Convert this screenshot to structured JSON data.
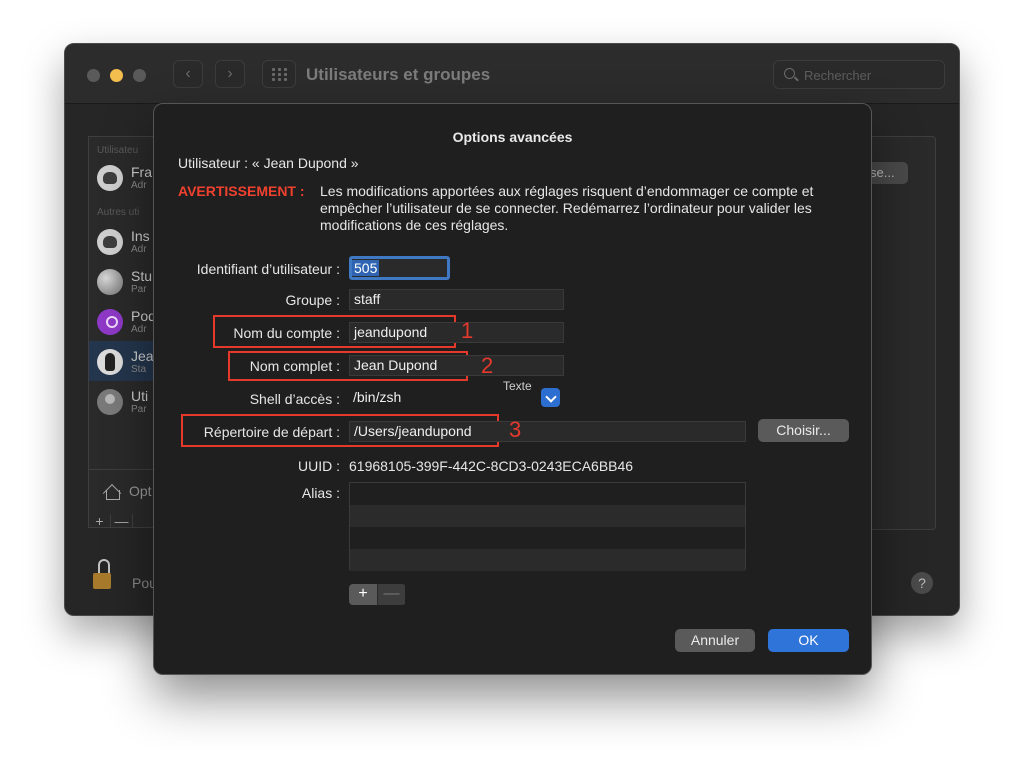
{
  "window": {
    "title": "Utilisateurs et groupes",
    "search_placeholder": "Rechercher",
    "nav_back": "‹",
    "nav_forward": "›"
  },
  "sidebar": {
    "section_current": "Utilisateu",
    "section_others": "Autres uti",
    "users": [
      {
        "name": "Fra",
        "role": "Adr",
        "avatar": "cat-icon"
      },
      {
        "name": "Ins",
        "role": "Adr",
        "avatar": "cat-icon"
      },
      {
        "name": "Stu",
        "role": "Par",
        "avatar": "ball-icon"
      },
      {
        "name": "Pod",
        "role": "Adr",
        "avatar": "podcast-icon"
      },
      {
        "name": "Jea",
        "role": "Sta",
        "avatar": "penguin-icon"
      },
      {
        "name": "Uti",
        "role": "Par",
        "avatar": "user-icon"
      }
    ],
    "options_label": "Opt",
    "plus": "+",
    "minus": "—"
  },
  "footer": {
    "lock_text": "Pou",
    "help": "?"
  },
  "bg_button_label": "se...",
  "dialog": {
    "title": "Options avancées",
    "user_line": "Utilisateur :  « Jean Dupond »",
    "warning_label": "AVERTISSEMENT :",
    "warning_text": "Les modifications apportées aux réglages risquent d’endommager ce compte et empêcher l’utilisateur de se connecter. Redémarrez l’ordinateur pour valider les modifications de ces réglages.",
    "fields": {
      "uid_label": "Identifiant d’utilisateur :",
      "uid_value": "505",
      "group_label": "Groupe :",
      "group_value": "staff",
      "account_label": "Nom du compte :",
      "account_value": "jeandupond",
      "fullname_label": "Nom complet :",
      "fullname_value": "Jean Dupond",
      "shell_label": "Shell d’accès :",
      "shell_value": "/bin/zsh",
      "home_label": "Répertoire de départ :",
      "home_value": "/Users/jeandupond",
      "uuid_label": "UUID :",
      "uuid_value": "61968105-399F-442C-8CD3-0243ECA6BB46",
      "alias_label": "Alias :"
    },
    "tooltip": "Texte",
    "annotations": [
      "1",
      "2",
      "3"
    ],
    "choose_button": "Choisir...",
    "alias_plus": "+",
    "alias_minus": "—",
    "cancel_button": "Annuler",
    "ok_button": "OK"
  },
  "colors": {
    "warning": "#f0412f",
    "annotation": "#e4392b",
    "accent": "#2f74d8"
  }
}
